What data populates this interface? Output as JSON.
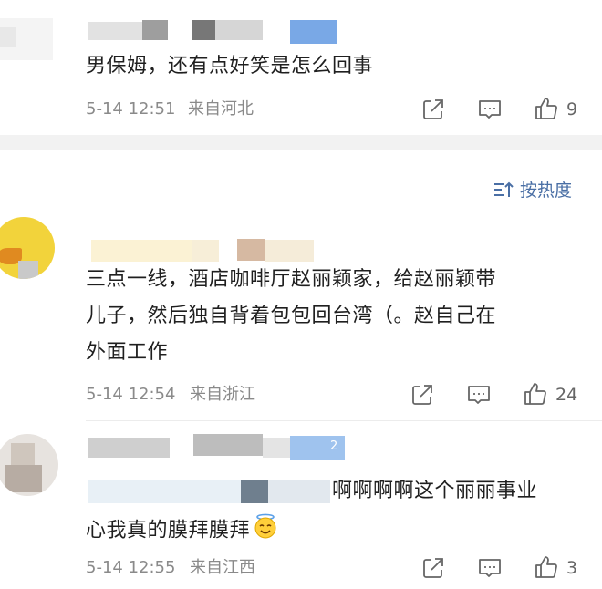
{
  "comments": [
    {
      "text": "男保姆，还有点好笑是怎么回事",
      "time": "5-14 12:51",
      "location": "来自河北",
      "likes": "9"
    },
    {
      "text_lines": [
        "三点一线，酒店咖啡厅赵丽颖家，给赵丽颖带",
        "儿子，然后独自背着包包回台湾（。赵自己在",
        "外面工作"
      ],
      "time": "5-14 12:54",
      "location": "来自浙江",
      "likes": "24"
    },
    {
      "text_line1": "啊啊啊啊这个丽丽事业",
      "text_line2": "心我真的膜拜膜拜",
      "time": "5-14 12:55",
      "location": "来自江西",
      "likes": "3",
      "blurred_badge": "2"
    }
  ],
  "sort": {
    "label": "按热度",
    "icon": "sort-icon"
  },
  "icons": [
    "share-icon",
    "comment-icon",
    "like-icon",
    "angel-emoji-icon"
  ],
  "colors": {
    "accent": "#4a6fa5",
    "meta": "#8a8a8a",
    "divider": "#f2f2f2"
  }
}
